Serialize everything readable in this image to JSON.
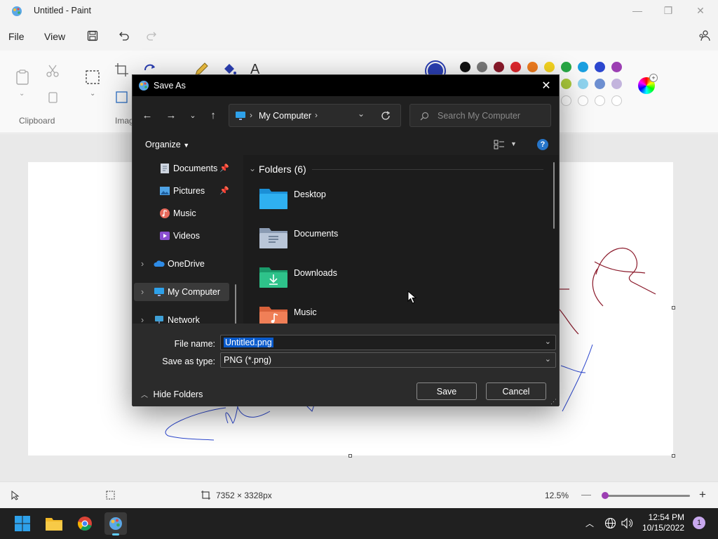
{
  "window": {
    "title": "Untitled - Paint",
    "minimize_icon": "—",
    "maximize_icon": "❐",
    "close_icon": "✕"
  },
  "menu": {
    "file": "File",
    "view": "View"
  },
  "ribbon": {
    "clipboard_label": "Clipboard",
    "image_label": "Imag"
  },
  "palette": {
    "row1": [
      "#111111",
      "#7a7a7a",
      "#8b1a2b",
      "#e0282e",
      "#f07c1e",
      "#f4d320",
      "#28a745",
      "#1a9fe0",
      "#2c47cf",
      "#9c3fb3"
    ],
    "row2": [
      "#ffffff",
      "#c3c3c3",
      "#b97a57",
      "#f2b3c6",
      "#ffc90e",
      "#eee39a",
      "#a9c83a",
      "#8fd3ee",
      "#6d8fd1",
      "#c3b4dd"
    ],
    "primary": "#2b3fb3"
  },
  "status": {
    "dimensions": "7352 × 3328px",
    "zoom": "12.5%"
  },
  "taskbar": {
    "time": "12:54 PM",
    "date": "10/15/2022",
    "badge": "1"
  },
  "dialog": {
    "title": "Save As",
    "address": "My Computer",
    "search_placeholder": "Search My Computer",
    "organize": "Organize",
    "nav": [
      "Documents",
      "Pictures",
      "Music",
      "Videos",
      "OneDrive",
      "My Computer",
      "Network"
    ],
    "folders_header": "Folders (6)",
    "folders": [
      "Desktop",
      "Documents",
      "Downloads",
      "Music"
    ],
    "file_name_label": "File name:",
    "file_name": "Untitled.png",
    "type_label": "Save as type:",
    "type_value": "PNG (*.png)",
    "hide_folders": "Hide Folders",
    "save": "Save",
    "cancel": "Cancel"
  }
}
